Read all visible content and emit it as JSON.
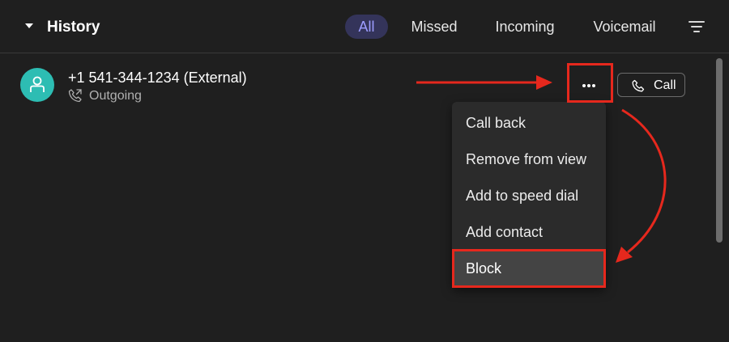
{
  "header": {
    "title": "History",
    "tabs": [
      {
        "label": "All",
        "active": true
      },
      {
        "label": "Missed",
        "active": false
      },
      {
        "label": "Incoming",
        "active": false
      },
      {
        "label": "Voicemail",
        "active": false
      }
    ]
  },
  "call_entry": {
    "number": "+1 541-344-1234 (External)",
    "direction": "Outgoing",
    "call_button_label": "Call"
  },
  "context_menu": {
    "items": [
      {
        "label": "Call back"
      },
      {
        "label": "Remove from view"
      },
      {
        "label": "Add to speed dial"
      },
      {
        "label": "Add contact"
      },
      {
        "label": "Block",
        "highlighted": true
      }
    ]
  },
  "colors": {
    "background": "#1f1f1f",
    "avatar": "#2dbdb3",
    "active_tab_bg": "#34345a",
    "active_tab_text": "#9d9dff",
    "annotation": "#e6281d"
  },
  "icons": {
    "collapse": "caret-down-icon",
    "filter": "filter-lines-icon",
    "avatar": "person-icon",
    "outgoing": "phone-outgoing-icon",
    "more": "ellipsis-icon",
    "call": "phone-icon"
  }
}
